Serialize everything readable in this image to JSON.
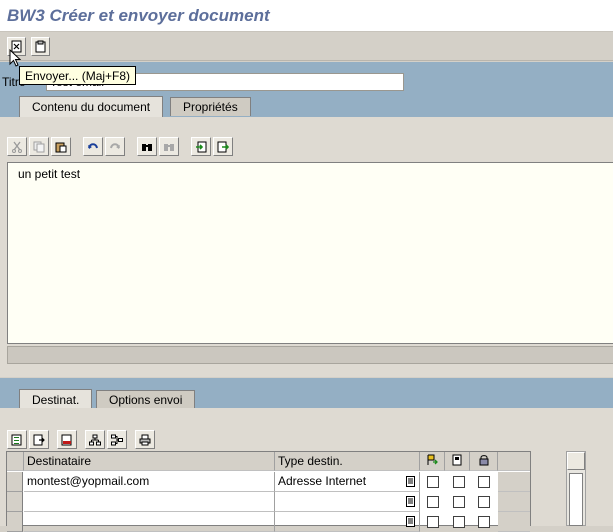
{
  "window": {
    "title": "BW3 Créer et envoyer document"
  },
  "app_toolbar": {
    "buttons": [
      {
        "name": "send-button",
        "icon": "send-document-icon"
      },
      {
        "name": "clipboard-button",
        "icon": "clipboard-icon"
      }
    ],
    "tooltip": "Envoyer...   (Maj+F8)"
  },
  "document": {
    "title_label": "Titre",
    "title_value": "Test email"
  },
  "tabs_top": [
    {
      "label": "Contenu du document",
      "active": true
    },
    {
      "label": "Propriétés",
      "active": false
    }
  ],
  "editor": {
    "text": "un petit test",
    "toolbar_icons": [
      "cut-icon",
      "copy-icon",
      "paste-icon",
      "undo-icon",
      "redo-icon",
      "find-icon",
      "find-next-icon",
      "import-icon",
      "export-icon"
    ]
  },
  "tabs_bottom": [
    {
      "label": "Destinat.",
      "active": true
    },
    {
      "label": "Options envoi",
      "active": false
    }
  ],
  "recipients": {
    "toolbar_icons": [
      "details-icon",
      "insert-row-icon",
      "delete-row-icon",
      "distribution-list-icon",
      "address-book-icon",
      "print-icon"
    ],
    "columns": [
      "Destinataire",
      "Type destin."
    ],
    "flag_icons": [
      "express-icon",
      "copy-icon",
      "lock-icon"
    ],
    "rows": [
      {
        "recipient": "montest@yopmail.com",
        "type": "Adresse Internet"
      },
      {
        "recipient": "",
        "type": ""
      },
      {
        "recipient": "",
        "type": ""
      }
    ]
  },
  "colors": {
    "band_blue": "#94afc4",
    "title_text": "#5d6f9b",
    "tooltip_bg": "#ffffe1",
    "editor_bg": "#fffff5"
  }
}
